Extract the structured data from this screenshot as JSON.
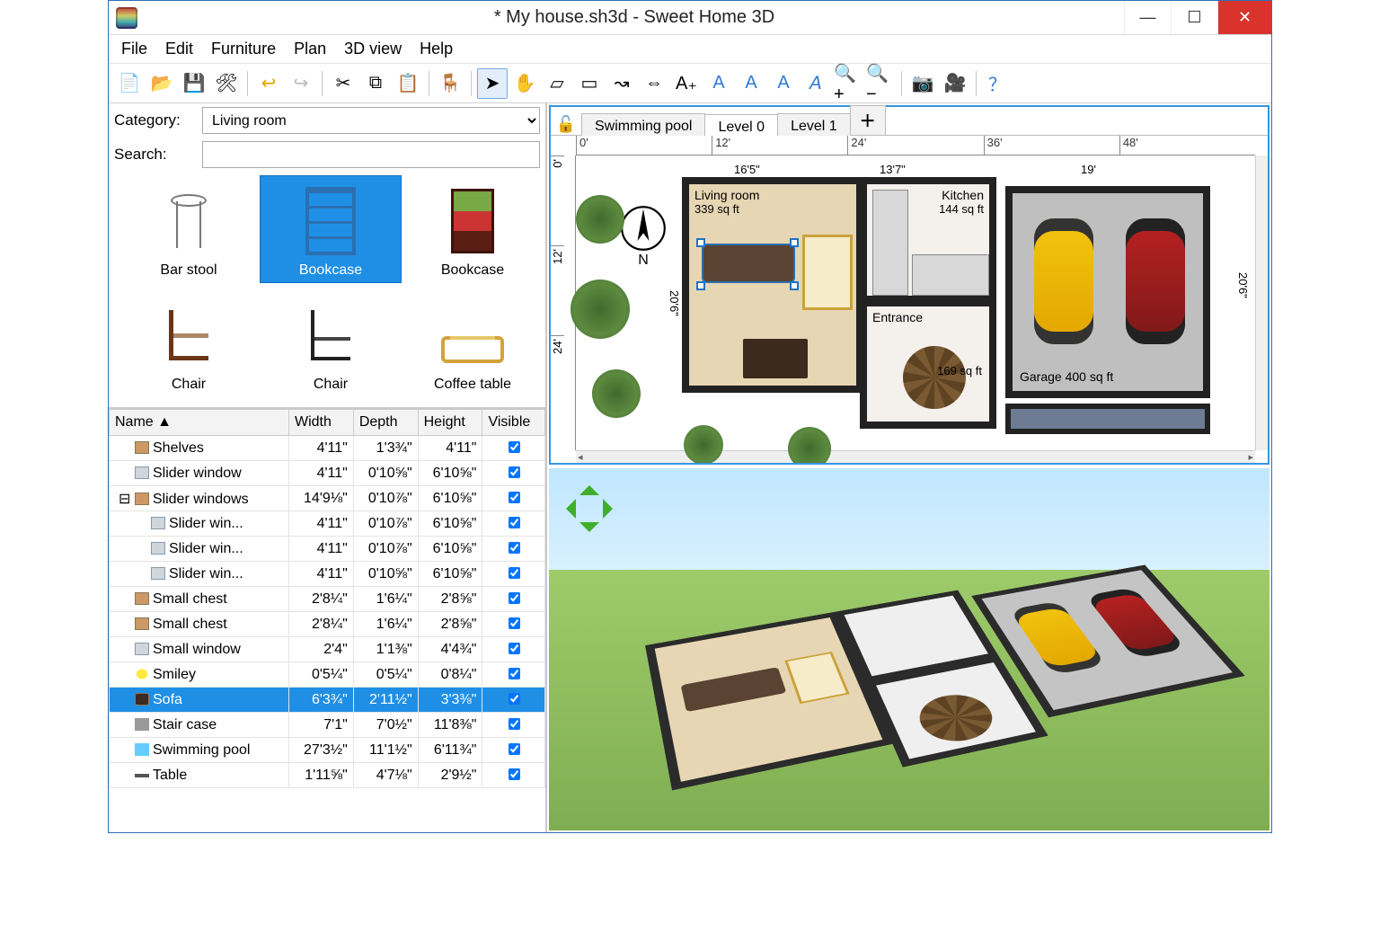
{
  "title": "* My house.sh3d - Sweet Home 3D",
  "menu": [
    "File",
    "Edit",
    "Furniture",
    "Plan",
    "3D view",
    "Help"
  ],
  "toolbar": [
    {
      "n": "new-file-icon",
      "g": "📄"
    },
    {
      "n": "open-file-icon",
      "g": "📂"
    },
    {
      "n": "save-file-icon",
      "g": "💾"
    },
    {
      "n": "preferences-icon",
      "g": "🛠"
    },
    {
      "sep": true
    },
    {
      "n": "undo-icon",
      "g": "↩",
      "c": "#e0a500"
    },
    {
      "n": "redo-icon",
      "g": "↪",
      "c": "#bbb"
    },
    {
      "sep": true
    },
    {
      "n": "cut-icon",
      "g": "✂"
    },
    {
      "n": "copy-icon",
      "g": "⧉"
    },
    {
      "n": "paste-icon",
      "g": "📋"
    },
    {
      "sep": true
    },
    {
      "n": "add-furniture-icon",
      "g": "🪑"
    },
    {
      "sep": true
    },
    {
      "n": "select-tool-icon",
      "g": "➤",
      "active": true
    },
    {
      "n": "pan-tool-icon",
      "g": "✋"
    },
    {
      "n": "create-walls-icon",
      "g": "▱"
    },
    {
      "n": "create-rooms-icon",
      "g": "▭"
    },
    {
      "n": "create-polylines-icon",
      "g": "↝"
    },
    {
      "n": "create-dimensions-icon",
      "g": "⇔"
    },
    {
      "n": "create-text-icon",
      "g": "A₊"
    },
    {
      "n": "increase-text-icon",
      "g": "A",
      "c": "#2f7bd0"
    },
    {
      "n": "decrease-text-icon",
      "g": "A",
      "c": "#2f7bd0"
    },
    {
      "n": "bold-icon",
      "g": "A",
      "c": "#2f7bd0"
    },
    {
      "n": "italic-icon",
      "g": "𝘈",
      "c": "#2f7bd0"
    },
    {
      "n": "zoom-in-icon",
      "g": "🔍+"
    },
    {
      "n": "zoom-out-icon",
      "g": "🔍−"
    },
    {
      "sep": true
    },
    {
      "n": "photo-icon",
      "g": "📷"
    },
    {
      "n": "video-icon",
      "g": "🎥"
    },
    {
      "sep": true
    },
    {
      "n": "help-icon",
      "g": "？",
      "c": "#2f7bd0"
    }
  ],
  "catalog": {
    "category_label": "Category:",
    "category_value": "Living room",
    "search_label": "Search:",
    "search_value": "",
    "items": [
      {
        "n": "Bar stool",
        "icon": "i-barstool"
      },
      {
        "n": "Bookcase",
        "icon": "i-bookcase1",
        "selected": true
      },
      {
        "n": "Bookcase",
        "icon": "i-bookcase2"
      },
      {
        "n": "Chair",
        "icon": "i-chair1"
      },
      {
        "n": "Chair",
        "icon": "i-chair2"
      },
      {
        "n": "Coffee table",
        "icon": "i-coffee"
      }
    ]
  },
  "table": {
    "headers": [
      "Name ▲",
      "Width",
      "Depth",
      "Height",
      "Visible"
    ],
    "rows": [
      {
        "pad": 22,
        "ic": "",
        "n": "Shelves",
        "w": "4'11\"",
        "d": "1'3¾\"",
        "h": "4'11\"",
        "v": true
      },
      {
        "pad": 22,
        "ic": "win",
        "n": "Slider window",
        "w": "4'11\"",
        "d": "0'10⅝\"",
        "h": "6'10⅝\"",
        "v": true
      },
      {
        "pad": 4,
        "ic": "",
        "n": "Slider windows",
        "w": "14'9⅛\"",
        "d": "0'10⅞\"",
        "h": "6'10⅝\"",
        "v": true,
        "exp": true
      },
      {
        "pad": 40,
        "ic": "win",
        "n": "Slider win...",
        "w": "4'11\"",
        "d": "0'10⅞\"",
        "h": "6'10⅝\"",
        "v": true
      },
      {
        "pad": 40,
        "ic": "win",
        "n": "Slider win...",
        "w": "4'11\"",
        "d": "0'10⅞\"",
        "h": "6'10⅝\"",
        "v": true
      },
      {
        "pad": 40,
        "ic": "win",
        "n": "Slider win...",
        "w": "4'11\"",
        "d": "0'10⅝\"",
        "h": "6'10⅝\"",
        "v": true
      },
      {
        "pad": 22,
        "ic": "",
        "n": "Small chest",
        "w": "2'8¼\"",
        "d": "1'6¼\"",
        "h": "2'8⅝\"",
        "v": true
      },
      {
        "pad": 22,
        "ic": "",
        "n": "Small chest",
        "w": "2'8¼\"",
        "d": "1'6¼\"",
        "h": "2'8⅝\"",
        "v": true
      },
      {
        "pad": 22,
        "ic": "win",
        "n": "Small window",
        "w": "2'4\"",
        "d": "1'1⅜\"",
        "h": "4'4¾\"",
        "v": true
      },
      {
        "pad": 22,
        "ic": "smiley",
        "n": "Smiley",
        "w": "0'5¼\"",
        "d": "0'5¼\"",
        "h": "0'8¼\"",
        "v": true
      },
      {
        "pad": 22,
        "ic": "sofa",
        "n": "Sofa",
        "w": "6'3¾\"",
        "d": "2'11½\"",
        "h": "3'3⅜\"",
        "v": true,
        "selected": true
      },
      {
        "pad": 22,
        "ic": "stair",
        "n": "Stair case",
        "w": "7'1\"",
        "d": "7'0½\"",
        "h": "11'8⅜\"",
        "v": true
      },
      {
        "pad": 22,
        "ic": "pool",
        "n": "Swimming pool",
        "w": "27'3½\"",
        "d": "11'1½\"",
        "h": "6'11¾\"",
        "v": true
      },
      {
        "pad": 22,
        "ic": "table",
        "n": "Table",
        "w": "1'11⅝\"",
        "d": "4'7⅛\"",
        "h": "2'9½\"",
        "v": true
      }
    ]
  },
  "tabs": {
    "items": [
      "Swimming pool",
      "Level 0",
      "Level 1"
    ],
    "active": 1
  },
  "ruler_h": [
    "0'",
    "12'",
    "24'",
    "36'",
    "48'"
  ],
  "ruler_v": [
    "0'",
    "12'",
    "24'"
  ],
  "plan": {
    "compass": "N",
    "rooms": {
      "living": {
        "name": "Living room",
        "area": "339 sq ft"
      },
      "kitchen": {
        "name": "Kitchen",
        "area": "144 sq ft"
      },
      "entrance": {
        "name": "Entrance",
        "area": "169 sq ft"
      },
      "garage": {
        "name": "Garage",
        "area": "400 sq ft"
      }
    },
    "dims": {
      "a": "16'5\"",
      "b": "13'7\"",
      "c": "19'",
      "d": "20'6\"",
      "e": "20'6\""
    }
  }
}
